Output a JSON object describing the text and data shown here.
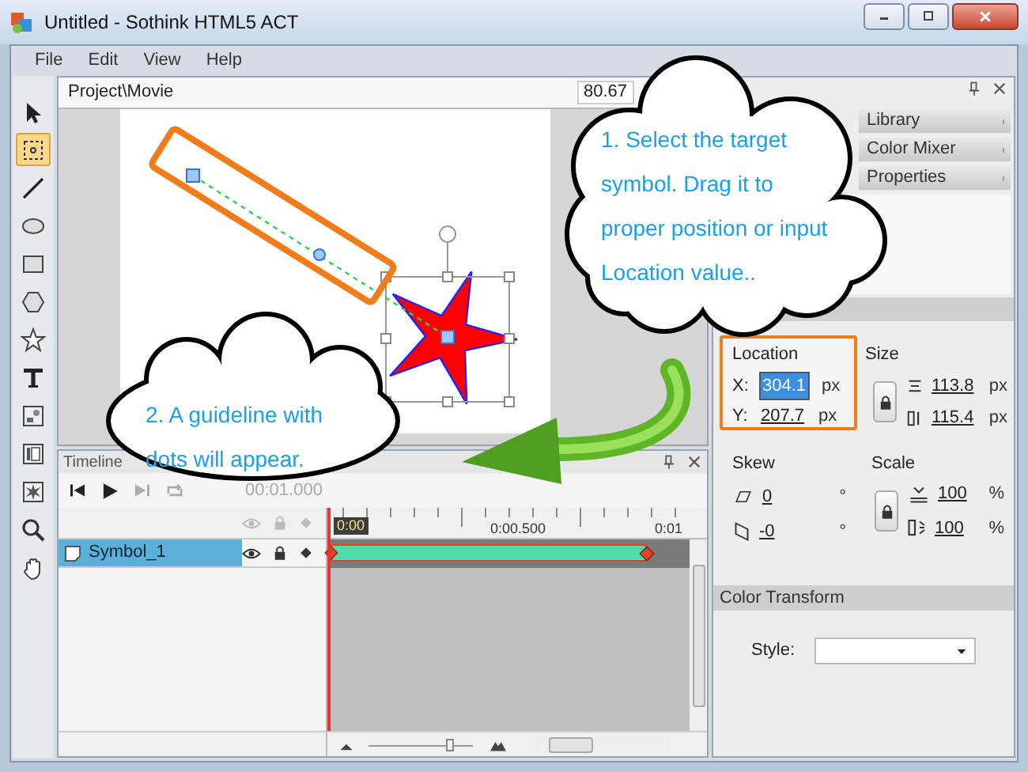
{
  "window": {
    "title": "Untitled - Sothink HTML5 ACT"
  },
  "menu": [
    "File",
    "Edit",
    "View",
    "Help"
  ],
  "tools": [
    {
      "kind": "pointer",
      "selected": false
    },
    {
      "kind": "transform",
      "selected": true
    },
    {
      "kind": "line",
      "selected": false
    },
    {
      "kind": "ellipse",
      "selected": false
    },
    {
      "kind": "rectangle",
      "selected": false
    },
    {
      "kind": "hexagon",
      "selected": false
    },
    {
      "kind": "star",
      "selected": false
    },
    {
      "kind": "text",
      "selected": false
    },
    {
      "kind": "picture",
      "selected": false
    },
    {
      "kind": "panel",
      "selected": false
    },
    {
      "kind": "burst",
      "selected": false
    },
    {
      "kind": "zoom",
      "selected": false
    },
    {
      "kind": "hand",
      "selected": false
    }
  ],
  "document": {
    "path": "Project\\Movie",
    "zoom": "80.67"
  },
  "callouts": [
    {
      "lines": [
        "1. Select the target",
        "symbol. Drag it to",
        "proper position or input",
        "Location value.."
      ]
    },
    {
      "lines": [
        "2. A guideline with",
        "dots will appear."
      ]
    }
  ],
  "timeline": {
    "title": "Timeline",
    "time": "00:01.000",
    "zoom_slider": {
      "level": 0.8
    },
    "ruler": [
      "0:00",
      "0:00.500",
      "0:01"
    ],
    "layers": [
      {
        "name": "Symbol_1",
        "selected": true
      }
    ]
  },
  "panel": {
    "tabs": [
      {
        "label": "Library"
      },
      {
        "label": "Color Mixer"
      },
      {
        "label": "Properties"
      }
    ],
    "location": {
      "title": "Location",
      "x": {
        "label": "X:",
        "value": "304.1",
        "unit": "px",
        "selected": true
      },
      "y": {
        "label": "Y:",
        "value": "207.7",
        "unit": "px",
        "selected": false
      }
    },
    "size": {
      "title": "Size",
      "width": {
        "value": "113.8",
        "unit": "px"
      },
      "height": {
        "value": "115.4",
        "unit": "px"
      }
    },
    "skew": {
      "title": "Skew",
      "x": {
        "value": "0",
        "unit": "°"
      },
      "y": {
        "value": "-0",
        "unit": "°"
      }
    },
    "scale": {
      "title": "Scale",
      "x": {
        "value": "100",
        "unit": "%"
      },
      "y": {
        "value": "100",
        "unit": "%"
      }
    },
    "color_transform": {
      "title": "Color Transform",
      "style_label": "Style:"
    }
  }
}
